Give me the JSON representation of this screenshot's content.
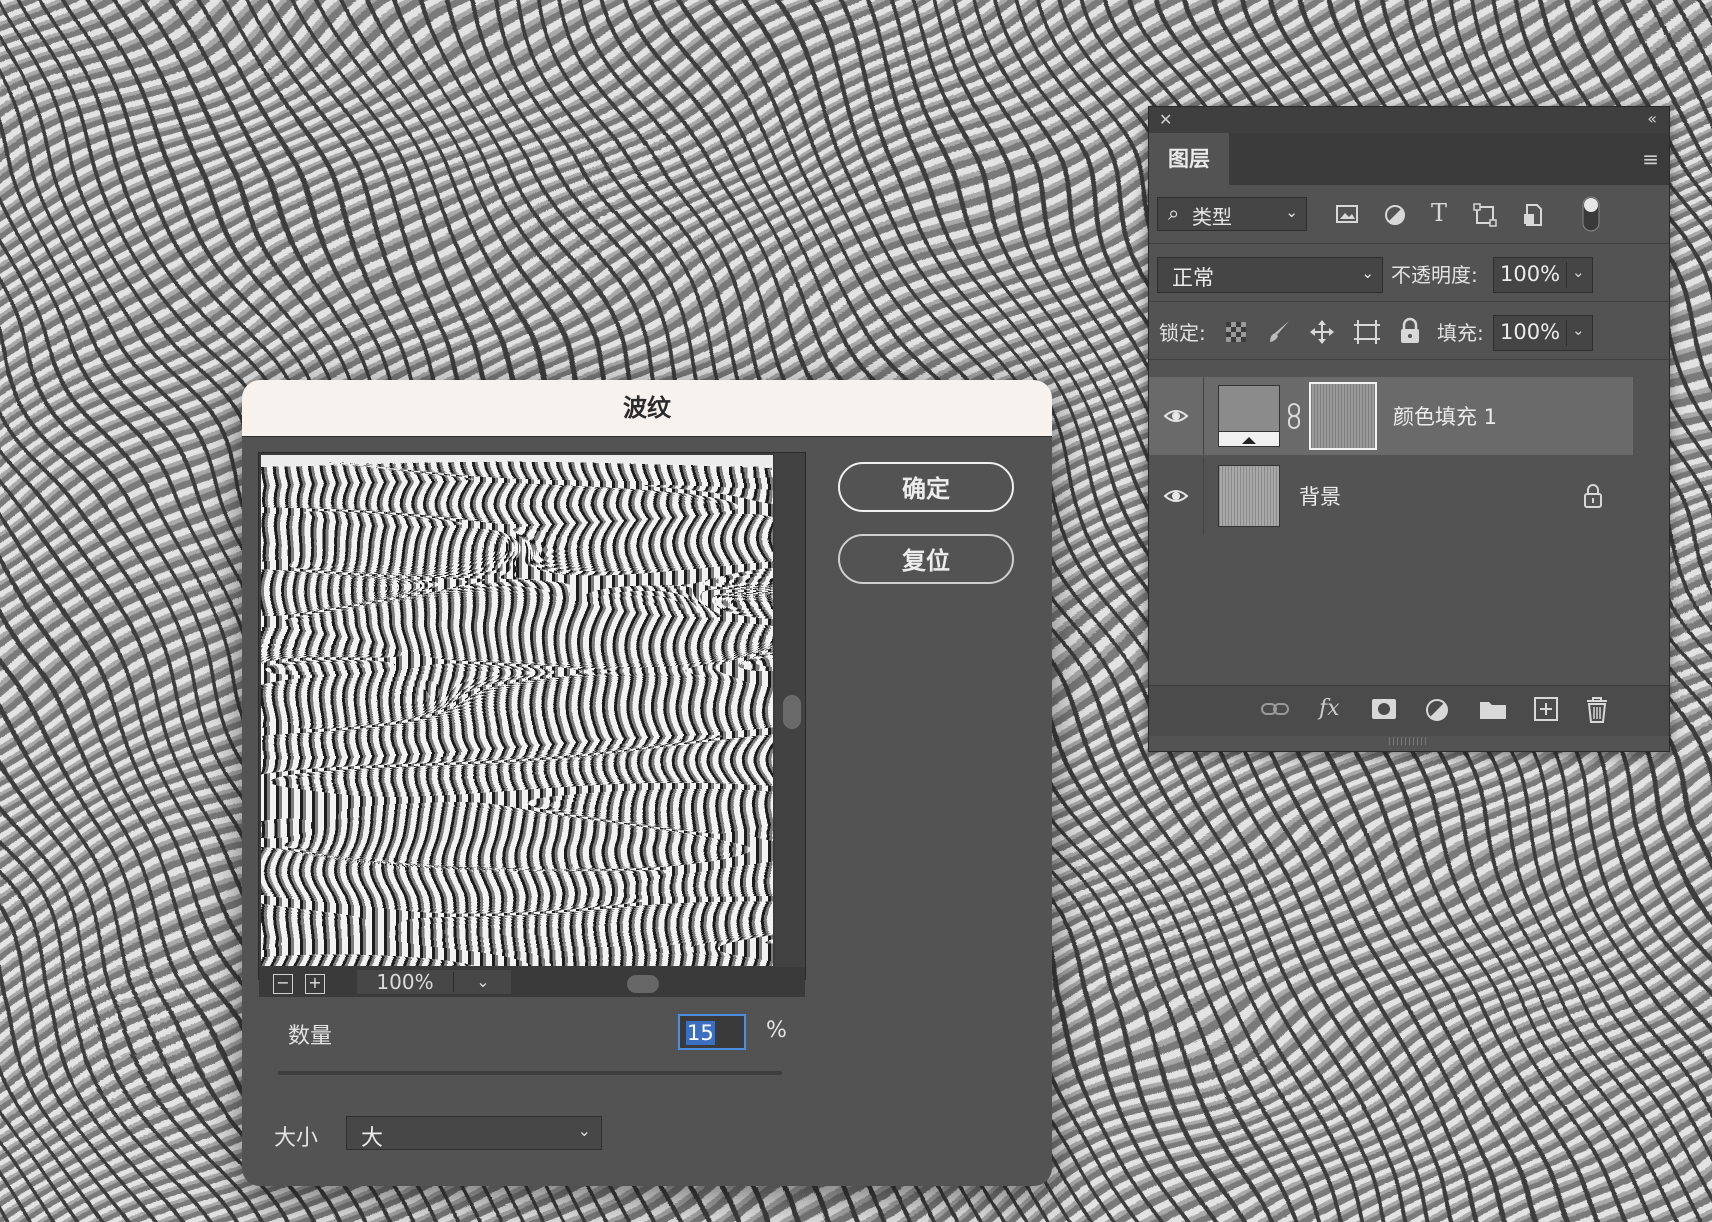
{
  "dialog": {
    "title": "波纹",
    "ok_label": "确定",
    "reset_label": "复位",
    "zoom_value": "100%",
    "zoom_out_label": "−",
    "zoom_in_label": "+",
    "amount_label": "数量",
    "amount_value": "15",
    "amount_unit": "%",
    "amount_slider_fraction": 0.52,
    "size_label": "大小",
    "size_value": "大"
  },
  "layers_panel": {
    "tab_label": "图层",
    "filter_label": "类型",
    "blend_mode": "正常",
    "opacity_label": "不透明度:",
    "opacity_value": "100%",
    "lock_label": "锁定:",
    "fill_label": "填充:",
    "fill_value": "100%",
    "layers": [
      {
        "name": "颜色填充 1",
        "selected": true
      },
      {
        "name": "背景",
        "selected": false
      }
    ]
  },
  "colors": {
    "dialog_bg": "#535353",
    "title_bar": "#f7f2ee",
    "accent": "#4d8dde"
  }
}
